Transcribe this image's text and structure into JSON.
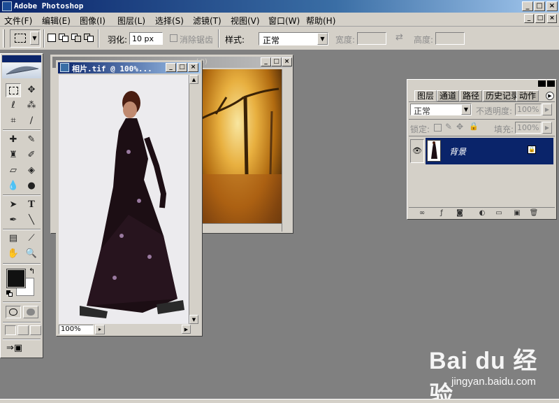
{
  "app": {
    "title": "Adobe Photoshop",
    "window_buttons": {
      "minimize": "_",
      "maximize": "□",
      "close": "×"
    }
  },
  "menu": [
    {
      "label": "文件(F)"
    },
    {
      "label": "编辑(E)"
    },
    {
      "label": "图像(I)"
    },
    {
      "label": "图层(L)"
    },
    {
      "label": "选择(S)"
    },
    {
      "label": "滤镜(T)"
    },
    {
      "label": "视图(V)"
    },
    {
      "label": "窗口(W)"
    },
    {
      "label": "帮助(H)"
    }
  ],
  "options_bar": {
    "feather_label": "羽化:",
    "feather_value": "10 px",
    "antialias_label": "消除锯齿",
    "style_label": "样式:",
    "style_value": "正常",
    "width_label": "宽度:",
    "height_label": "高度:"
  },
  "documents": {
    "photo": {
      "title": "相片.tif @ 100%...",
      "zoom": "100%"
    },
    "background": {
      "title": "...(#)"
    }
  },
  "layers_panel": {
    "tabs": [
      "图层",
      "通道",
      "路径",
      "历史记录",
      "动作"
    ],
    "blend_mode": "正常",
    "opacity_label": "不透明度:",
    "opacity_value": "100%",
    "lock_label": "锁定:",
    "fill_label": "填充:",
    "fill_value": "100%",
    "layers": [
      {
        "name": "背景",
        "visible": true,
        "locked": true
      }
    ]
  },
  "colors": {
    "foreground": "#111111",
    "background": "#ffffff",
    "selected_layer": "#0a246a",
    "title_active": "#0a246a"
  },
  "watermark": {
    "logo": "Bai du 经验",
    "url": "jingyan.baidu.com"
  }
}
